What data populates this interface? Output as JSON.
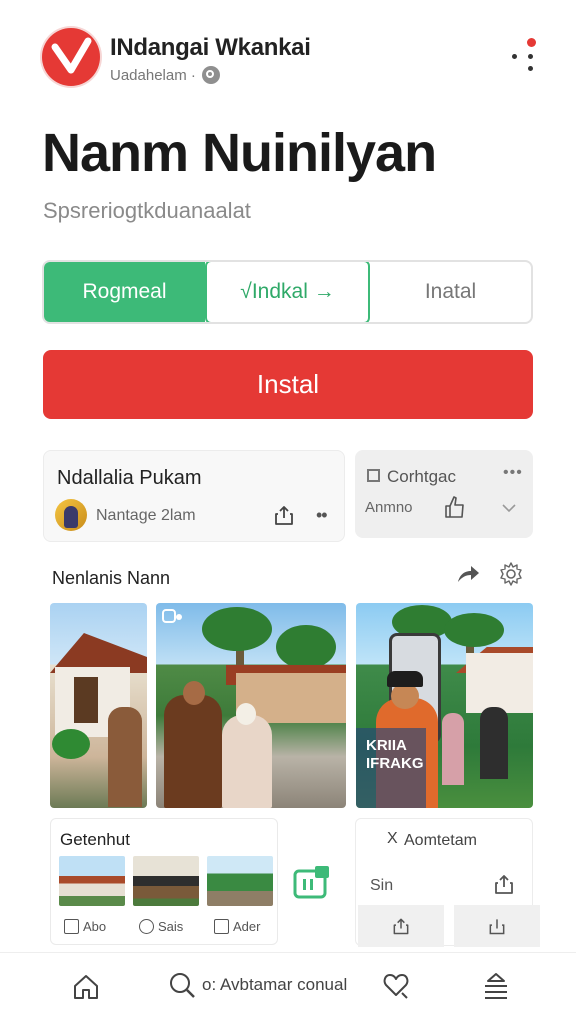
{
  "header": {
    "app_name": "INdangai Wkankai",
    "subtitle": "Uadahelam ·"
  },
  "title": "Nanm Nuinilyan",
  "tagline": "Spsreriogtkduanaalat",
  "segments": [
    "Rogmeal",
    "√Indkal →",
    "Inatal"
  ],
  "install_label": "Instal",
  "card_featured": {
    "title": "Ndallalia Pukam",
    "author": "Nantage 2lam"
  },
  "card_side": {
    "title": "Corhtgac",
    "subtitle": "Anmno"
  },
  "gallery": {
    "title": "Nenlanis Nann",
    "photo3_text": "KRIIA\nIFRAKG"
  },
  "bottom_card": {
    "title": "Getenhut",
    "actions": [
      "Abo",
      "Sais",
      "Ader"
    ]
  },
  "bottom_side": {
    "title": "Aomtetam",
    "x_mark": "X",
    "subtitle": "Sin"
  },
  "navbar": {
    "search_text": "o: Avbtamar conual"
  },
  "colors": {
    "accent_red": "#e53935",
    "accent_green": "#3dba78"
  },
  "icons": [
    "logo-icon",
    "globe-icon",
    "more-icon",
    "share-icon",
    "thumb-icon",
    "chevron-down-icon",
    "forward-icon",
    "gear-icon",
    "home-icon",
    "search-icon",
    "heart-icon",
    "menu-icon"
  ]
}
